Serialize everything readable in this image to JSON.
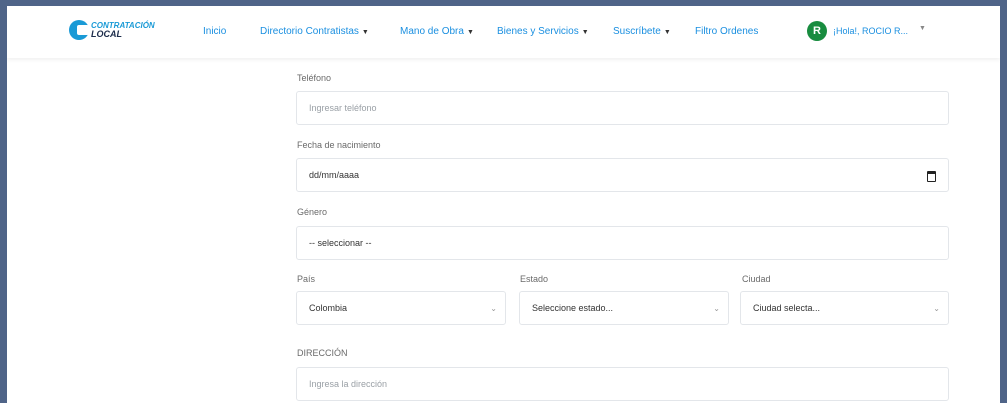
{
  "brand": {
    "line1": "CONTRATACIÓN",
    "line2": "LOCAL"
  },
  "nav": {
    "items": [
      {
        "label": "Inicio"
      },
      {
        "label": "Directorio Contratistas",
        "dropdown": true
      },
      {
        "label": "Mano de Obra",
        "dropdown": true
      },
      {
        "label": "Bienes y Servicios",
        "dropdown": true
      },
      {
        "label": "Suscríbete",
        "dropdown": true
      },
      {
        "label": "Filtro Ordenes"
      }
    ],
    "user": {
      "initial": "R",
      "greeting": "¡Hola!, ROCIO R..."
    }
  },
  "form": {
    "phone": {
      "label": "Teléfono",
      "placeholder": "Ingresar teléfono"
    },
    "birthdate": {
      "label": "Fecha de nacimiento",
      "value": "dd/mm/aaaa"
    },
    "gender": {
      "label": "Género",
      "value": "-- seleccionar --"
    },
    "country": {
      "label": "País",
      "value": "Colombia"
    },
    "state": {
      "label": "Estado",
      "value": "Seleccione estado..."
    },
    "city": {
      "label": "Ciudad",
      "value": "Ciudad selecta..."
    },
    "address": {
      "label": "DIRECCIÓN",
      "placeholder": "Ingresa la dirección"
    }
  },
  "colors": {
    "brand_blue": "#1a9ad6",
    "nav_link": "#1a8fe0",
    "avatar_green": "#188c3f",
    "outer_bg": "#4f6488"
  }
}
